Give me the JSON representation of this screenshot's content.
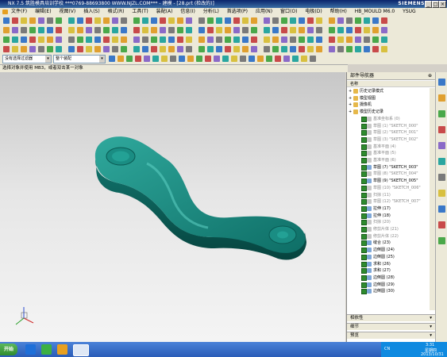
{
  "window": {
    "title": "NX 7.5 筑胜模具培训学校 ***0769-88693800 WWW.NJZL.COM*** - 建模 - [28.prt (检改的)]",
    "brand": "SIEMENS",
    "controls": [
      "_",
      "□",
      "×"
    ]
  },
  "menu": [
    "文件(F)",
    "编辑(E)",
    "视图(V)",
    "插入(S)",
    "格式(R)",
    "工具(T)",
    "装配(A)",
    "信息(I)",
    "分析(L)",
    "首选项(P)",
    "应用(N)",
    "窗口(O)",
    "电极(D)",
    "帮助(H)",
    "HB_MOULD M6.0",
    "YSUG"
  ],
  "filter": {
    "type_filter": "没有选择过滤器",
    "scope": "整个装配",
    "cue": "选择对象并使用 MB3，或者双击某一对象"
  },
  "navigator": {
    "title": "部件导航器",
    "column": "名称",
    "rows": [
      {
        "label": "历史记录模式",
        "state": "normal",
        "indent": 1
      },
      {
        "label": "模型视图",
        "state": "normal",
        "indent": 1
      },
      {
        "label": "摄像机",
        "state": "normal",
        "indent": 1
      },
      {
        "label": "模型历史记录",
        "state": "normal",
        "indent": 1
      },
      {
        "label": "基准坐标系 (0)",
        "state": "dim",
        "indent": 2
      },
      {
        "label": "草图 (1) \"SKETCH_000\"",
        "state": "dim",
        "indent": 2
      },
      {
        "label": "草图 (2) \"SKETCH_001\"",
        "state": "dim",
        "indent": 2
      },
      {
        "label": "草图 (3) \"SKETCH_002\"",
        "state": "dim",
        "indent": 2
      },
      {
        "label": "基准平面 (4)",
        "state": "dim",
        "indent": 2
      },
      {
        "label": "基准平面 (5)",
        "state": "dim",
        "indent": 2
      },
      {
        "label": "基准平面 (6)",
        "state": "dim",
        "indent": 2
      },
      {
        "label": "草图 (7) \"SKETCH_003\"",
        "state": "normal",
        "indent": 2
      },
      {
        "label": "草图 (8) \"SKETCH_004\"",
        "state": "dim",
        "indent": 2
      },
      {
        "label": "草图 (9) \"SKETCH_005\"",
        "state": "normal",
        "indent": 2
      },
      {
        "label": "草图 (10) \"SKETCH_006\"",
        "state": "dim",
        "indent": 2
      },
      {
        "label": "扫掠 (11)",
        "state": "dim",
        "indent": 2
      },
      {
        "label": "草图 (12) \"SKETCH_007\"",
        "state": "dim",
        "indent": 2
      },
      {
        "label": "拉伸 (17)",
        "state": "normal",
        "indent": 2
      },
      {
        "label": "拉伸 (18)",
        "state": "normal",
        "indent": 2
      },
      {
        "label": "扫掠 (20)",
        "state": "dim",
        "indent": 2
      },
      {
        "label": "修剪片体 (21)",
        "state": "dim",
        "indent": 2
      },
      {
        "label": "修剪片体 (22)",
        "state": "dim",
        "indent": 2
      },
      {
        "label": "缝合 (23)",
        "state": "normal",
        "indent": 2
      },
      {
        "label": "边倒圆 (24)",
        "state": "normal",
        "indent": 2
      },
      {
        "label": "边倒圆 (25)",
        "state": "normal",
        "indent": 2
      },
      {
        "label": "求和 (26)",
        "state": "normal",
        "indent": 2
      },
      {
        "label": "求和 (27)",
        "state": "normal",
        "indent": 2
      },
      {
        "label": "边倒圆 (28)",
        "state": "normal",
        "indent": 2
      },
      {
        "label": "边倒圆 (29)",
        "state": "normal",
        "indent": 2
      },
      {
        "label": "边倒圆 (30)",
        "state": "normal",
        "indent": 2
      }
    ],
    "panels": [
      "相依性",
      "细节",
      "预览"
    ]
  },
  "taskbar": {
    "start": "开始",
    "lang": "CN",
    "time": "3:31",
    "weekday": "星期四",
    "date": "2013/10/31"
  },
  "colors": {
    "model": "#0f7a72",
    "model_light": "#2fb3a5",
    "check": "#2e8b2e"
  }
}
